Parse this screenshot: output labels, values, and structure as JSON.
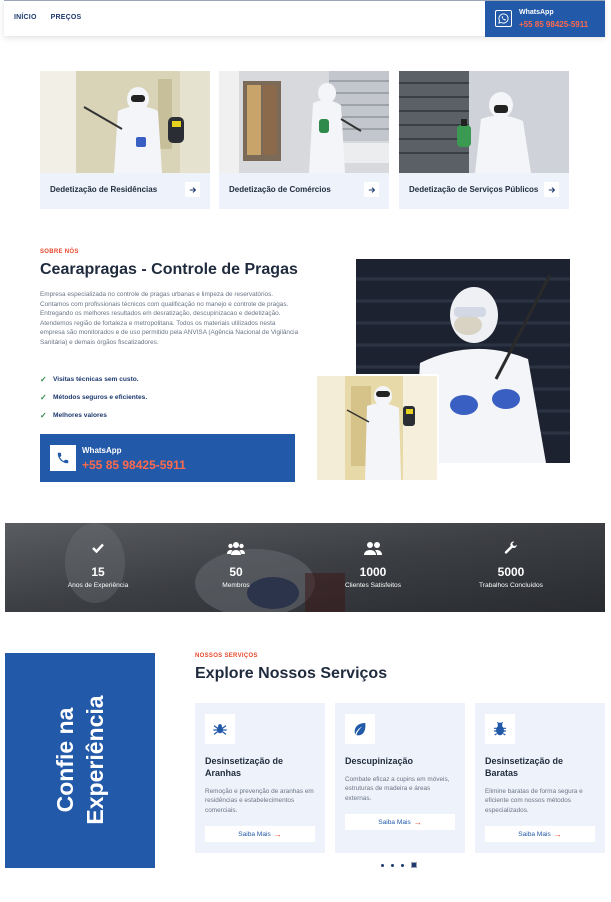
{
  "header": {
    "nav": [
      {
        "label": "INÍCIO"
      },
      {
        "label": "PREÇOS"
      }
    ],
    "whatsapp": {
      "label": "WhatsApp",
      "phone": "+55 85 98425-5911"
    }
  },
  "cards": [
    {
      "label": "Dedetização de Residências",
      "icon": "arrow-right-icon"
    },
    {
      "label": "Dedetização de Comércios",
      "icon": "arrow-right-icon"
    },
    {
      "label": "Dedetização de Serviços Públicos",
      "icon": "arrow-right-icon"
    }
  ],
  "about": {
    "eyebrow": "SOBRE NÓS",
    "title": "Cearapragas - Controle de Pragas",
    "description": "Empresa especializada no controle de pragas urbanas e limpeza de reservatórios. Contamos com profissionais técnicos com qualificação no manejo e controle de pragas. Entregando os melhores resultados em desratização, descupinizacao e dedetização. Atendemos região de fortaleza e metropolitana. Todos os materiais utilizados nesta empresa são monitorados e de uso permitido pela ANVISA (Agência Nacional de Vigilância Sanitária) e demais órgãos fiscalizadores.",
    "checks": [
      "Visitas técnicas sem custo.",
      "Métodos seguros e eficientes.",
      "Melhores valores"
    ],
    "whatsapp": {
      "label": "WhatsApp",
      "phone": "+55 85 98425-5911"
    }
  },
  "stats": [
    {
      "value": "15",
      "label": "Anos de Experiência",
      "icon": "check-icon"
    },
    {
      "value": "50",
      "label": "Membros",
      "icon": "users-group-icon"
    },
    {
      "value": "1000",
      "label": "Clientes Satisfeitos",
      "icon": "users-icon"
    },
    {
      "value": "5000",
      "label": "Trabalhos Concluídos",
      "icon": "wrench-icon"
    }
  ],
  "confie": {
    "line1": "Confie na",
    "line2": "Experiência"
  },
  "services": {
    "eyebrow": "NOSSOS SERVIÇOS",
    "title": "Explore Nossos Serviços",
    "items": [
      {
        "title": "Desinsetização de Aranhas",
        "desc": "Remoção e prevenção de aranhas em residências e estabelecimentos comerciais.",
        "button": "Saiba Mais",
        "icon": "spider-icon"
      },
      {
        "title": "Descupinização",
        "desc": "Combate eficaz a cupins em móveis, estruturas de madeira e áreas externas.",
        "button": "Saiba Mais",
        "icon": "leaf-icon"
      },
      {
        "title": "Desinsetização de Baratas",
        "desc": "Elimine baratas de forma segura e eficiente com nossos métodos especializados.",
        "button": "Saiba Mais",
        "icon": "bug-icon"
      }
    ]
  },
  "colors": {
    "brand_blue": "#2259a8",
    "accent_orange": "#e8472a",
    "dark_text": "#1f2b3d",
    "card_bg": "#eef2fa"
  }
}
